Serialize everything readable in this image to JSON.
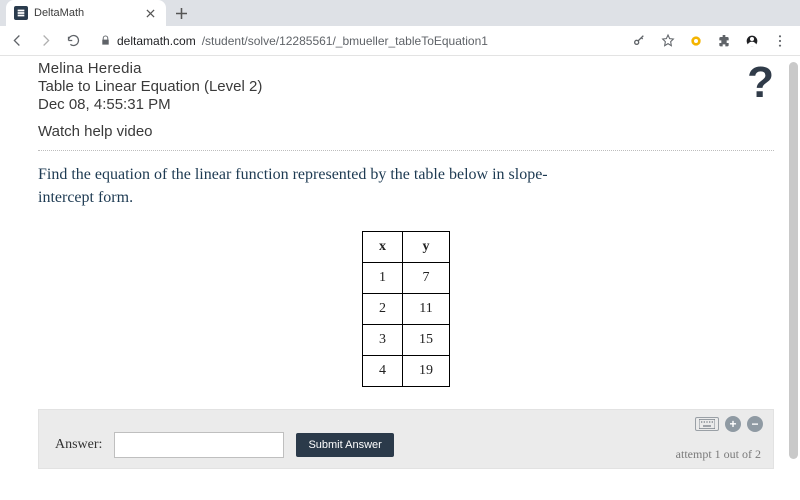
{
  "browser": {
    "tab_title": "DeltaMath",
    "url_domain": "deltamath.com",
    "url_path": "/student/solve/12285561/_bmueller_tableToEquation1"
  },
  "header": {
    "student_name": "Melina Heredia",
    "assignment": "Table to Linear Equation (Level 2)",
    "timestamp": "Dec 08, 4:55:31 PM",
    "help_link": "Watch help video",
    "help_icon_glyph": "?"
  },
  "question": {
    "prompt": "Find the equation of the linear function represented by the table below in slope-intercept form."
  },
  "table": {
    "headers": [
      "x",
      "y"
    ],
    "rows": [
      [
        "1",
        "7"
      ],
      [
        "2",
        "11"
      ],
      [
        "3",
        "15"
      ],
      [
        "4",
        "19"
      ]
    ]
  },
  "answer": {
    "label": "Answer:",
    "input_value": "",
    "submit_label": "Submit Answer",
    "attempt_text": "attempt 1 out of 2"
  }
}
